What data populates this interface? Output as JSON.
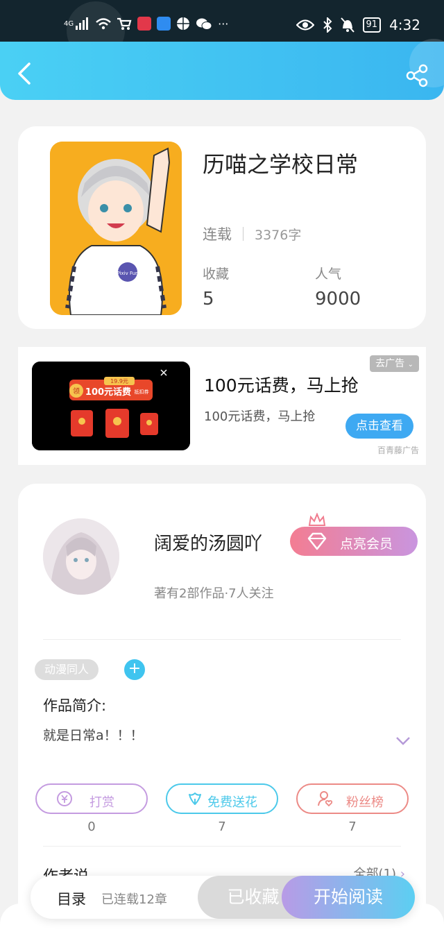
{
  "status_bar": {
    "network": "4G",
    "battery": "91",
    "time": "4:32",
    "more": "···",
    "icons": [
      "signal-icon",
      "wifi-icon",
      "cart-icon",
      "book-app-icon",
      "search-app-icon",
      "basketball-icon",
      "wechat-icon",
      "eye-icon",
      "bluetooth-icon",
      "mute-icon"
    ]
  },
  "header": {
    "back_icon": "back-arrow-icon",
    "share_icon": "share-icon",
    "gradient": [
      "#4ad0f4",
      "#3ab6f0"
    ]
  },
  "book": {
    "title": "历喵之学校日常",
    "status": "连载",
    "word_count": "3376字",
    "favorites_label": "收藏",
    "favorites_value": "5",
    "popularity_label": "人气",
    "popularity_value": "9000",
    "cover_badge": "Pixiv Fun"
  },
  "ad": {
    "close_label": "去广告",
    "image_price": "19.9元",
    "image_amount": "100元话费",
    "image_tag": "领",
    "image_sub": "抵扣券",
    "title": "100元话费，马上抢",
    "description": "100元话费，马上抢",
    "button": "点击查看",
    "source": "百青藤广告"
  },
  "author": {
    "name": "阔爱的汤圆吖",
    "meta": "著有2部作品·7人关注",
    "vip_button": "点亮会员"
  },
  "work": {
    "tag": "动漫同人",
    "add_tag": "+",
    "intro_label": "作品简介:",
    "intro_text": "就是日常a！！！"
  },
  "actions": [
    {
      "label": "打赏",
      "count": "0",
      "icon": "yen-coin-icon",
      "color": "#c49be0"
    },
    {
      "label": "免费送花",
      "count": "7",
      "icon": "flower-icon",
      "color": "#4cc9ea"
    },
    {
      "label": "粉丝榜",
      "count": "7",
      "icon": "fan-user-icon",
      "color": "#ec8a86"
    }
  ],
  "notice": {
    "label": "作者说",
    "all": "全部(1)"
  },
  "bottom_bar": {
    "toc": "目录",
    "serialized": "已连载12章",
    "favorited": "已收藏",
    "start_reading": "开始阅读"
  }
}
